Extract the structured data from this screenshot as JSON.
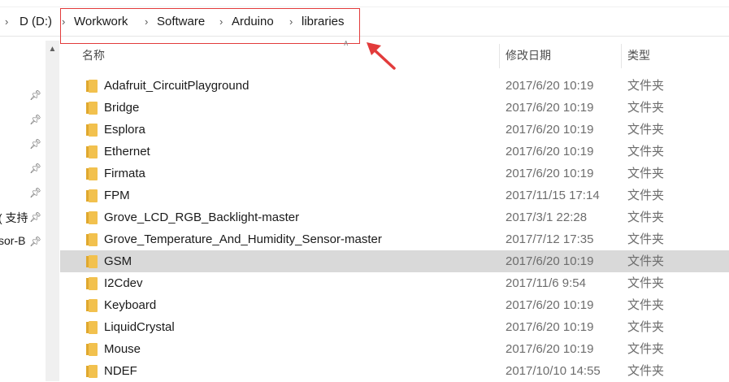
{
  "address_bar": {
    "drive": "D (D:)",
    "crumbs": [
      "Workwork",
      "Software",
      "Arduino",
      "libraries"
    ]
  },
  "nav_pane": {
    "labels": [
      "( 支持",
      "sor-B"
    ]
  },
  "columns": {
    "name": "名称",
    "date": "修改日期",
    "type": "类型"
  },
  "files": [
    {
      "name": "Adafruit_CircuitPlayground",
      "date": "2017/6/20 10:19",
      "type": "文件夹"
    },
    {
      "name": "Bridge",
      "date": "2017/6/20 10:19",
      "type": "文件夹"
    },
    {
      "name": "Esplora",
      "date": "2017/6/20 10:19",
      "type": "文件夹"
    },
    {
      "name": "Ethernet",
      "date": "2017/6/20 10:19",
      "type": "文件夹"
    },
    {
      "name": "Firmata",
      "date": "2017/6/20 10:19",
      "type": "文件夹"
    },
    {
      "name": "FPM",
      "date": "2017/11/15 17:14",
      "type": "文件夹"
    },
    {
      "name": "Grove_LCD_RGB_Backlight-master",
      "date": "2017/3/1 22:28",
      "type": "文件夹"
    },
    {
      "name": "Grove_Temperature_And_Humidity_Sensor-master",
      "date": "2017/7/12 17:35",
      "type": "文件夹"
    },
    {
      "name": "GSM",
      "date": "2017/6/20 10:19",
      "type": "文件夹"
    },
    {
      "name": "I2Cdev",
      "date": "2017/11/6 9:54",
      "type": "文件夹"
    },
    {
      "name": "Keyboard",
      "date": "2017/6/20 10:19",
      "type": "文件夹"
    },
    {
      "name": "LiquidCrystal",
      "date": "2017/6/20 10:19",
      "type": "文件夹"
    },
    {
      "name": "Mouse",
      "date": "2017/6/20 10:19",
      "type": "文件夹"
    },
    {
      "name": "NDEF",
      "date": "2017/10/10 14:55",
      "type": "文件夹"
    }
  ],
  "selected_file": "GSM",
  "colors": {
    "annotation": "#e23b3b",
    "folder": "#f2c14e",
    "selection": "#d9d9d9"
  }
}
